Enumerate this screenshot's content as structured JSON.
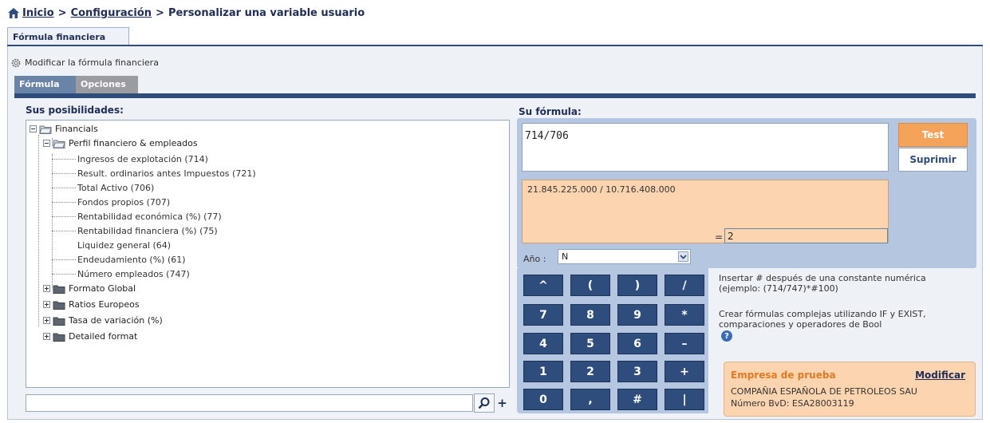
{
  "breadcrumb": {
    "home": "Inicio",
    "sep1": ">",
    "config": "Configuración",
    "sep2": ">",
    "current": "Personalizar una variable usuario"
  },
  "main_tab": "Fórmula financiera",
  "subtitle": "Modificar la fórmula financiera",
  "inner_tabs": [
    "Fórmula",
    "Opciones"
  ],
  "left_label": "Sus posibilidades:",
  "right_label": "Su fórmula:",
  "tree": {
    "root": "Financials",
    "group": "Perfil financiero & empleados",
    "leaves": [
      "Ingresos de explotación (714)",
      "Result. ordinarios antes Impuestos (721)",
      "Total Activo (706)",
      "Fondos propios (707)",
      "Rentabilidad económica (%) (77)",
      "Rentabilidad financiera (%) (75)",
      "Liquidez general (64)",
      "Endeudamiento (%) (61)",
      "Número empleados (747)"
    ],
    "folders": [
      "Formato Global",
      "Ratios Europeos",
      "Tasa de variación (%)",
      "Detailed format"
    ]
  },
  "formula": {
    "value": "714/706",
    "computed": "21.845.225.000 / 10.716.408.000",
    "eq": "=",
    "result": "2"
  },
  "buttons": {
    "test": "Test",
    "delete": "Suprimir"
  },
  "year": {
    "label": "Año :",
    "selected": "N"
  },
  "keypad": [
    [
      "^",
      "(",
      ")",
      "/"
    ],
    [
      "7",
      "8",
      "9",
      "*"
    ],
    [
      "4",
      "5",
      "6",
      "–"
    ],
    [
      "1",
      "2",
      "3",
      "+"
    ],
    [
      "0",
      ",",
      "#",
      "|"
    ]
  ],
  "help": {
    "line1": "Insertar # después de una constante numérica",
    "line2": "(ejemplo: (714/747)*#100)",
    "line3": "Crear fórmulas complejas utilizando IF y EXIST,",
    "line4": "comparaciones y operadores de Bool"
  },
  "company": {
    "name": "Empresa de prueba",
    "modify": "Modificar",
    "full_name": "COMPAÑIA ESPAÑOLA DE PETROLEOS SAU",
    "bvd": "Número BvD: ESA28003119"
  },
  "colors": {
    "navy": "#2f4d7c",
    "panel_blue": "#b4c6e0",
    "peach": "#fcd5b0",
    "orange": "#f5a25b"
  },
  "icons": [
    "home-icon",
    "gear-icon",
    "folder-icon",
    "search-icon",
    "help-icon",
    "dropdown-arrow-icon"
  ]
}
